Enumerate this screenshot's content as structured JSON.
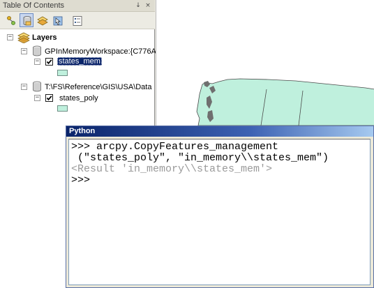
{
  "toc": {
    "title": "Table Of Contents",
    "pin_glyph": "↓",
    "close_glyph": "×",
    "tools": [
      {
        "name": "list-by-drawing-order-icon",
        "active": false
      },
      {
        "name": "list-by-source-icon",
        "active": true
      },
      {
        "name": "list-by-visibility-icon",
        "active": false
      },
      {
        "name": "list-by-selection-icon",
        "active": false
      },
      {
        "name": "options-icon",
        "active": false
      }
    ],
    "tree": {
      "root_label": "Layers",
      "workspace_1": "GPInMemoryWorkspace:{C776A",
      "layer_1": "states_mem",
      "workspace_2": "T:\\FS\\Reference\\GIS\\USA\\Data",
      "layer_2": "states_poly",
      "collapse_glyph": "−"
    }
  },
  "python": {
    "title": "Python",
    "lines": {
      "command_1": ">>> arcpy.CopyFeatures_management",
      "command_2": " (\"states_poly\", \"in_memory\\\\states_mem\")",
      "result": "<Result 'in_memory\\\\states_mem'>",
      "prompt": ">>>"
    }
  },
  "colors": {
    "selection": "#0a246a",
    "polygon_fill": "#bff0dd",
    "titlebar_start": "#0a246a",
    "titlebar_end": "#a6caf0",
    "result_text": "#9a9a9a"
  }
}
